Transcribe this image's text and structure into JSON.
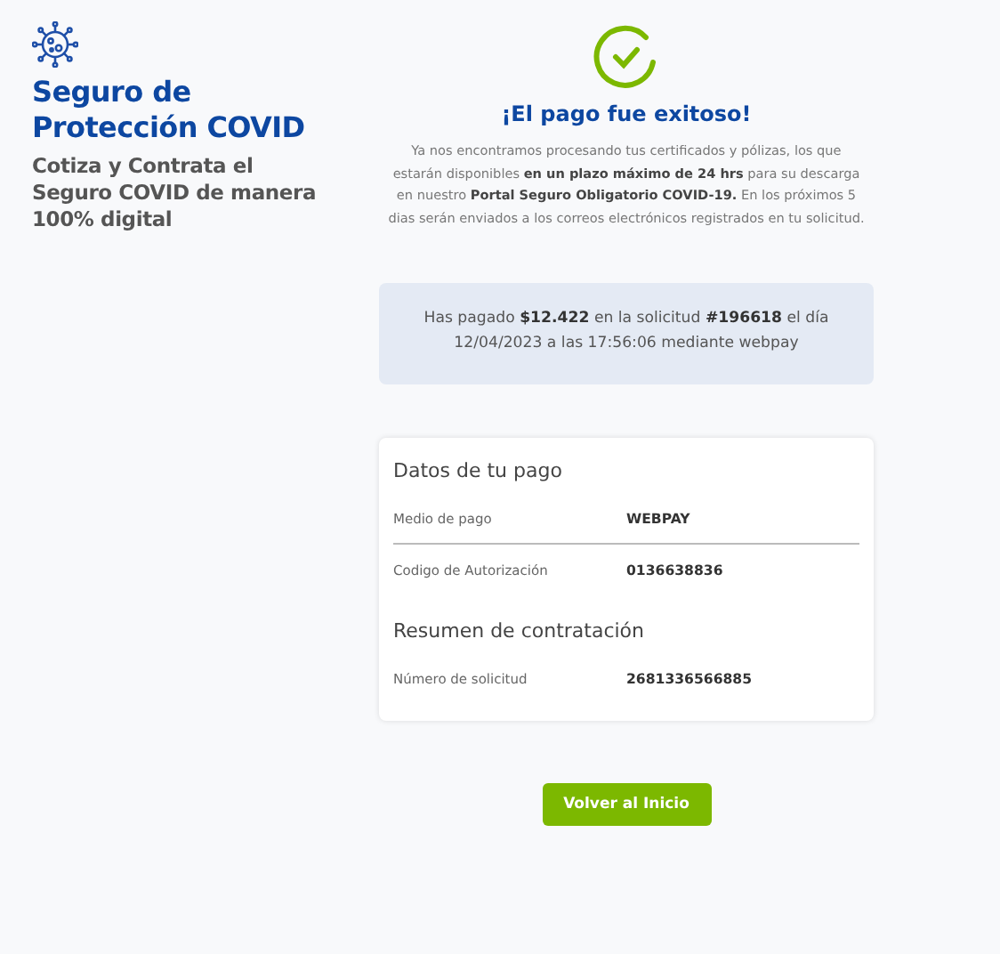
{
  "brand": {
    "title": "Seguro de Protección COVID",
    "subtitle": "Cotiza y Contrata el Seguro COVID de manera 100% digital"
  },
  "result": {
    "title": "¡El pago fue exitoso!",
    "message": "Ya nos encontramos procesando tus certificados y pólizas, los que estarán disponibles **en un plazo máximo de 24 hrs** para su descarga en nuestro **Portal Seguro Obligatorio COVID-19.** En los próximos 5 dias serán enviados a los correos electrónicos registrados en tu solicitud."
  },
  "summary": "Has pagado **$12.422** en la solicitud **#196618** el día 12/04/2023 a las 17:56:06 mediante webpay",
  "sections": [
    {
      "title": "Datos de tu pago",
      "rows": [
        {
          "label": "Medio de pago",
          "value": "WEBPAY"
        },
        {
          "label": "Codigo de Autorización",
          "value": "0136638836"
        }
      ]
    },
    {
      "title": "Resumen de contratación",
      "rows": [
        {
          "label": "Número de solicitud",
          "value": "2681336566885"
        }
      ]
    }
  ],
  "button": "Volver al Inicio"
}
